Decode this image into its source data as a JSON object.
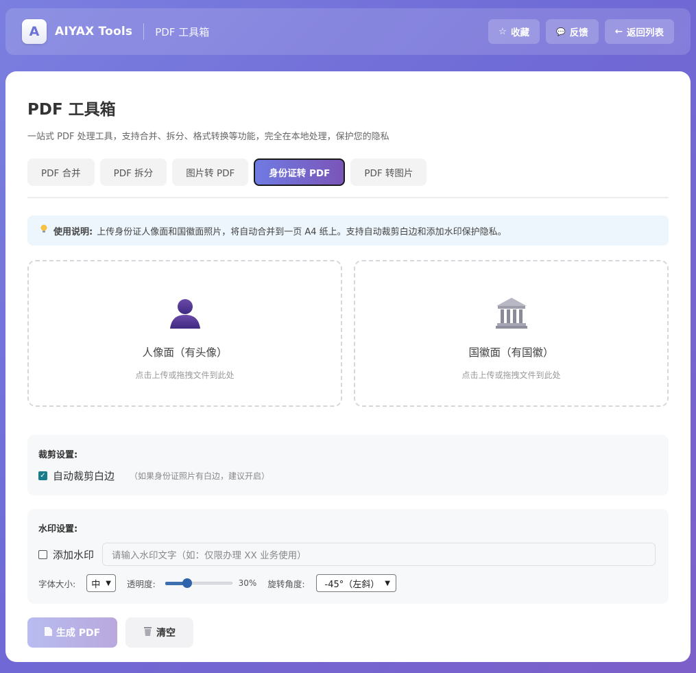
{
  "header": {
    "logo_letter": "A",
    "brand": "AIYAX Tools",
    "subtitle": "PDF 工具箱",
    "actions": [
      {
        "icon": "star-icon",
        "glyph": "☆",
        "label": "收藏"
      },
      {
        "icon": "speech-bubble-icon",
        "glyph": "💬",
        "label": "反馈"
      },
      {
        "icon": "arrow-left-icon",
        "glyph": "←",
        "label": "返回列表"
      }
    ]
  },
  "page": {
    "title": "PDF 工具箱",
    "description": "一站式 PDF 处理工具，支持合并、拆分、格式转换等功能，完全在本地处理，保护您的隐私"
  },
  "tabs": [
    {
      "label": "PDF 合并",
      "active": false
    },
    {
      "label": "PDF 拆分",
      "active": false
    },
    {
      "label": "图片转 PDF",
      "active": false
    },
    {
      "label": "身份证转 PDF",
      "active": true
    },
    {
      "label": "PDF 转图片",
      "active": false
    }
  ],
  "notice": {
    "icon": "lightbulb-icon",
    "label": "使用说明:",
    "text": "上传身份证人像面和国徽面照片，将自动合并到一页 A4 纸上。支持自动裁剪白边和添加水印保护隐私。"
  },
  "uploads": [
    {
      "icon": "person-silhouette-icon",
      "title": "人像面（有头像）",
      "hint": "点击上传或拖拽文件到此处"
    },
    {
      "icon": "classical-building-icon",
      "title": "国徽面（有国徽）",
      "hint": "点击上传或拖拽文件到此处"
    }
  ],
  "crop": {
    "title": "裁剪设置:",
    "checkbox_label": "自动裁剪白边",
    "checked": true,
    "hint": "（如果身份证照片有白边，建议开启）"
  },
  "watermark": {
    "title": "水印设置:",
    "checkbox_label": "添加水印",
    "checked": false,
    "placeholder": "请输入水印文字（如：仅限办理 XX 业务使用）",
    "font_size_label": "字体大小:",
    "font_size_value": "中",
    "opacity_label": "透明度:",
    "opacity_value": "30%",
    "opacity_fraction": 0.3,
    "rotation_label": "旋转角度:",
    "rotation_value": "-45°（左斜）"
  },
  "buttons": {
    "generate": {
      "icon": "document-icon",
      "label": "生成 PDF"
    },
    "clear": {
      "icon": "trash-icon",
      "label": "清空"
    }
  },
  "colors": {
    "accent_start": "#6f7be2",
    "accent_end": "#7b55b8",
    "checkbox": "#1a7c8a",
    "slider": "#3e6fb1"
  }
}
